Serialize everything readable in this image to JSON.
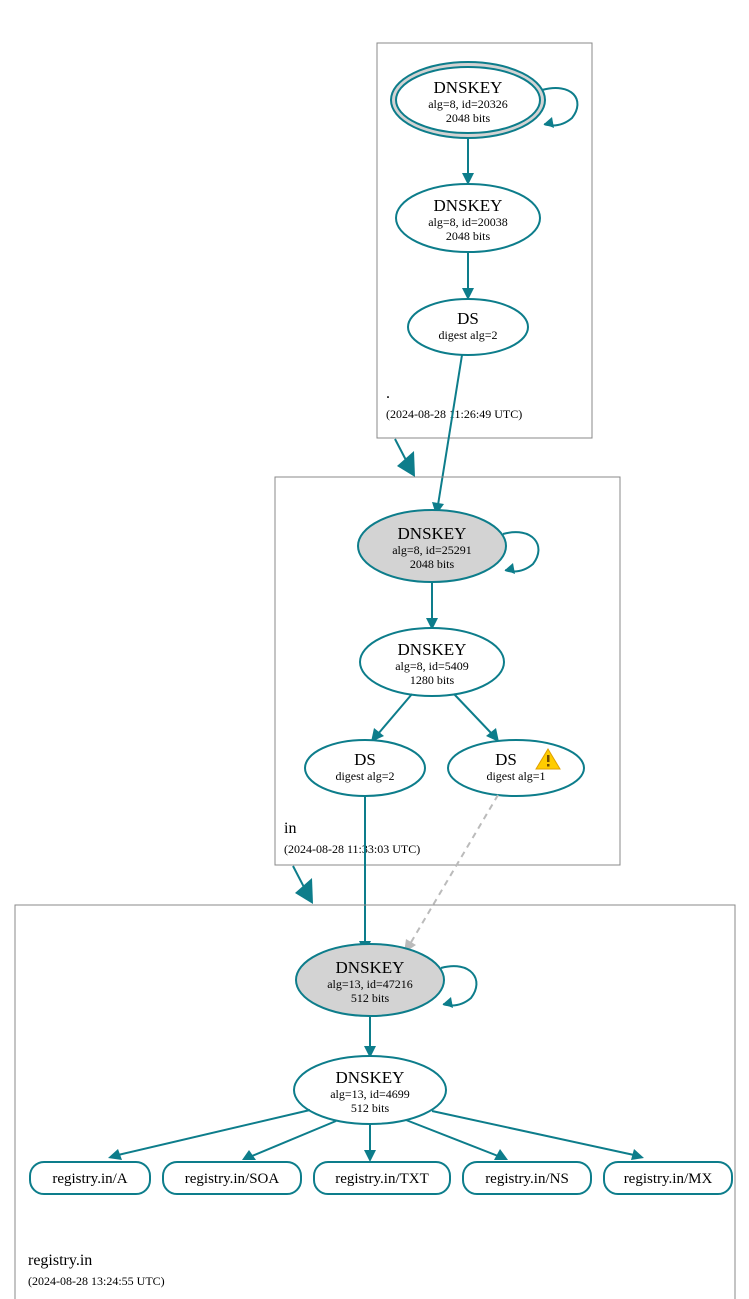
{
  "colors": {
    "accent": "#0d7d8b",
    "ksk_fill": "#d3d3d3",
    "warn_stroke": "#e0b100"
  },
  "zones": {
    "root": {
      "name": ".",
      "ts": "(2024-08-28 11:26:49 UTC)"
    },
    "in": {
      "name": "in",
      "ts": "(2024-08-28 11:33:03 UTC)"
    },
    "target": {
      "name": "registry.in",
      "ts": "(2024-08-28 13:24:55 UTC)"
    }
  },
  "nodes": {
    "root_ksk": {
      "title": "DNSKEY",
      "line2": "alg=8, id=20326",
      "line3": "2048 bits"
    },
    "root_zsk": {
      "title": "DNSKEY",
      "line2": "alg=8, id=20038",
      "line3": "2048 bits"
    },
    "root_ds": {
      "title": "DS",
      "line2": "digest alg=2"
    },
    "in_ksk": {
      "title": "DNSKEY",
      "line2": "alg=8, id=25291",
      "line3": "2048 bits"
    },
    "in_zsk": {
      "title": "DNSKEY",
      "line2": "alg=8, id=5409",
      "line3": "1280 bits"
    },
    "in_ds1": {
      "title": "DS",
      "line2": "digest alg=2"
    },
    "in_ds2": {
      "title": "DS",
      "line2": "digest alg=1"
    },
    "tgt_ksk": {
      "title": "DNSKEY",
      "line2": "alg=13, id=47216",
      "line3": "512 bits"
    },
    "tgt_zsk": {
      "title": "DNSKEY",
      "line2": "alg=13, id=4699",
      "line3": "512 bits"
    },
    "rr_a": {
      "label": "registry.in/A"
    },
    "rr_soa": {
      "label": "registry.in/SOA"
    },
    "rr_txt": {
      "label": "registry.in/TXT"
    },
    "rr_ns": {
      "label": "registry.in/NS"
    },
    "rr_mx": {
      "label": "registry.in/MX"
    }
  }
}
